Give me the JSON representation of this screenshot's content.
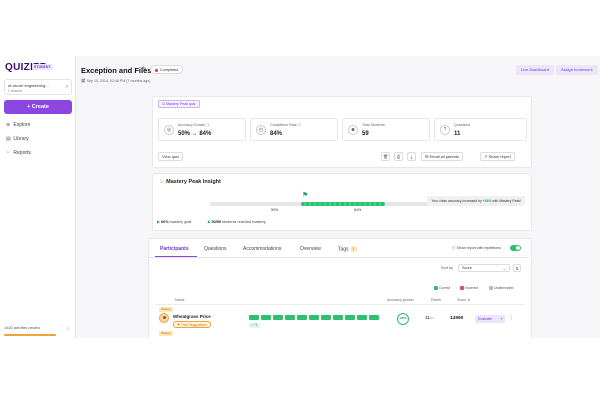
{
  "sidebar": {
    "logo": "QUIZIZZ",
    "logo_badge": "STUDENT",
    "org_name": "st·ctcore engineering...",
    "org_sub": "1 teacher",
    "create_label": "+ Create",
    "nav": [
      {
        "icon": "explore-icon",
        "glyph": "⊕",
        "label": "Explore"
      },
      {
        "icon": "library-icon",
        "glyph": "▤",
        "label": "Library"
      },
      {
        "icon": "reports-icon",
        "glyph": "◔",
        "label": "Reports"
      }
    ],
    "activities": "16/20 activities created"
  },
  "header": {
    "title": "Exception and Files",
    "status": "Completed",
    "date": "Sep 10, 2024, 02:48 PM (7 months ago)",
    "btn_dashboard": "Live Dashboard",
    "btn_assign": "Assign homework"
  },
  "summary": {
    "mode_tag": "Mastery Peak quiz",
    "stats": [
      {
        "icon": "accuracy-icon",
        "glyph": "◎",
        "label": "Accuracy Growth",
        "value": "50% → 84%"
      },
      {
        "icon": "completion-icon",
        "glyph": "◴",
        "label": "Completion Rate",
        "value": "84%"
      },
      {
        "icon": "students-icon",
        "glyph": "☻",
        "label": "Total Students",
        "value": "59"
      },
      {
        "icon": "questions-icon",
        "glyph": "?",
        "label": "Questions",
        "value": "11"
      }
    ],
    "btn_view_quiz": "View quiz",
    "btn_email": "Email all parents",
    "btn_share": "Share report"
  },
  "insight": {
    "title": "Mastery Peak Insight",
    "start_pct": "50%",
    "end_pct": "84%",
    "range_start_fraction": 0.5,
    "range_end_fraction": 0.84,
    "box_text_a": "Your class accuracy increased by ",
    "box_highlight": "+34%",
    "box_text_b": " with Mastery Peak!",
    "goal_bold": "60%",
    "goal_text": " mastery goal",
    "reached_bold": "50/59",
    "reached_text": " students reached mastery"
  },
  "participants": {
    "tabs": [
      "Participants",
      "Questions",
      "Accommodations",
      "Overview",
      "Tags"
    ],
    "tags_count": "1",
    "show_repetitions": "Show report with repetitions",
    "sort_label": "Sort by",
    "sort_value": "Score",
    "legend": [
      {
        "label": "Correct",
        "color": "#2fbf71"
      },
      {
        "label": "Incorrect",
        "color": "#e2456b"
      },
      {
        "label": "Unattempted",
        "color": "#b8b8c0"
      }
    ],
    "columns": {
      "name": "Name",
      "accuracy": "Accuracy growth",
      "points": "Points",
      "score": "Score"
    },
    "row": {
      "tag": "Mastery",
      "name": "Wheatgrass Price",
      "badge": "Fast Sluggrabber",
      "gain": "+ 71",
      "accuracy": "100%",
      "points": "11",
      "points_of": "/11",
      "score": "14990",
      "eval_label": "Evaluate",
      "correct_count": 11
    },
    "next_tag": "Mastery"
  }
}
